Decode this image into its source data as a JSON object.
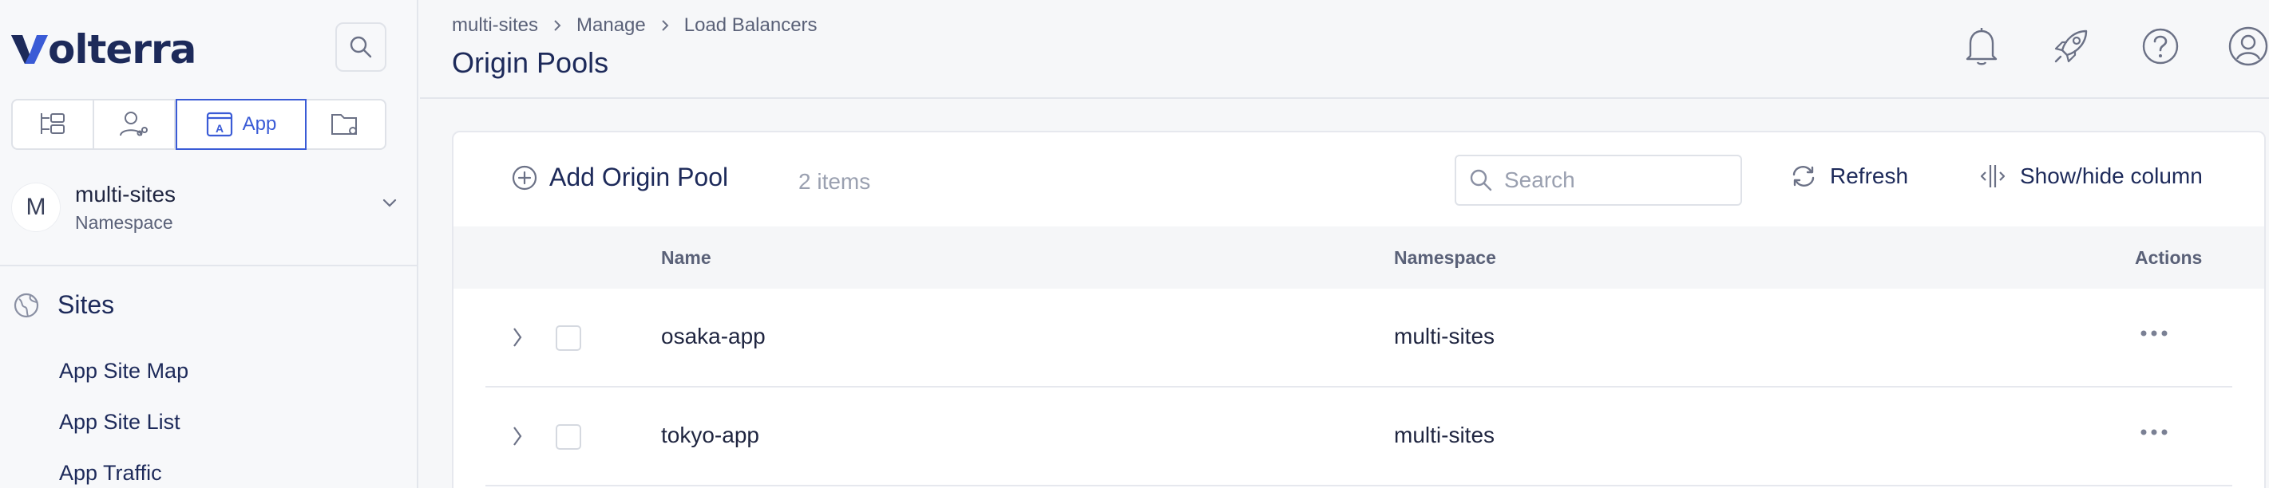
{
  "brand": {
    "logo_text": "olterra"
  },
  "sidebar": {
    "mode_tabs": [
      {
        "name": "tree-icon"
      },
      {
        "name": "user-share-icon"
      },
      {
        "name": "app-icon",
        "label": "App",
        "active": true
      },
      {
        "name": "folder-gear-icon"
      }
    ],
    "namespace": {
      "avatar": "M",
      "name": "multi-sites",
      "sub": "Namespace"
    },
    "section": {
      "label": "Sites"
    },
    "items": [
      {
        "label": "App Site Map"
      },
      {
        "label": "App Site List"
      },
      {
        "label": "App Traffic"
      }
    ]
  },
  "header": {
    "breadcrumb": [
      "multi-sites",
      "Manage",
      "Load Balancers"
    ],
    "title": "Origin Pools"
  },
  "toolbar": {
    "add_label": "Add Origin Pool",
    "count": "2 items",
    "search_placeholder": "Search",
    "refresh_label": "Refresh",
    "columns_label": "Show/hide column"
  },
  "table": {
    "headers": {
      "name": "Name",
      "namespace": "Namespace",
      "actions": "Actions"
    },
    "rows": [
      {
        "name": "osaka-app",
        "namespace": "multi-sites"
      },
      {
        "name": "tokyo-app",
        "namespace": "multi-sites"
      }
    ]
  },
  "colors": {
    "brand_navy": "#1d2a5a",
    "accent_blue": "#3a5bd6",
    "muted_text": "#5a6178"
  }
}
